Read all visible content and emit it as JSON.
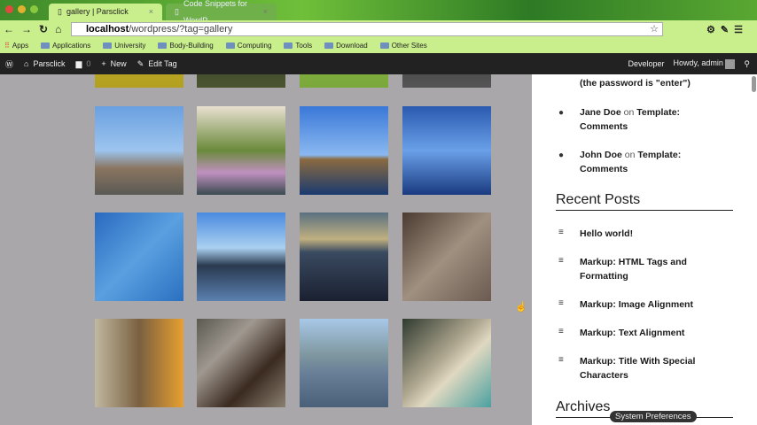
{
  "browser": {
    "tabs": [
      {
        "label": "gallery | Parsclick",
        "active": true
      },
      {
        "label": "Code Snippets for WordP",
        "active": false
      }
    ],
    "url_host": "localhost",
    "url_path": "/wordpress/?tag=gallery",
    "bookmarks": [
      "Apps",
      "Applications",
      "University",
      "Body-Building",
      "Computing",
      "Tools",
      "Download",
      "Other Sites"
    ]
  },
  "adminbar": {
    "site": "Parsclick",
    "comments": "0",
    "new": "New",
    "edit": "Edit Tag",
    "developer": "Developer",
    "howdy": "Howdy, admin"
  },
  "sidebar": {
    "comment_partial": "(the password is \"enter\")",
    "comments": [
      {
        "author": "Jane Doe",
        "on": "on",
        "post": "Template: Comments"
      },
      {
        "author": "John Doe",
        "on": "on",
        "post": "Template: Comments"
      }
    ],
    "recent_title": "Recent Posts",
    "recent": [
      "Hello world!",
      "Markup: HTML Tags and Formatting",
      "Markup: Image Alignment",
      "Markup: Text Alignment",
      "Markup: Title With Special Characters"
    ],
    "archives_title": "Archives"
  },
  "tooltip": "System Preferences",
  "gallery": [
    "linear-gradient(#c6b52a,#b4a020)",
    "linear-gradient(#2a3020,#4a5530)",
    "linear-gradient(#8fc04a,#7aa83a)",
    "linear-gradient(#2a2a30,#555)",
    "linear-gradient(#6aa0e0 0%,#9cc4ee 50%,#8a7560 70%,#5a5a55)",
    "linear-gradient(#e8e0d0,#6a8a3a 50%,#c090c0 75%,#3a4a50)",
    "linear-gradient(#3a78d8,#8ab8f0 55%,#8a6a40 60%,#1a3a70)",
    "linear-gradient(#2a5ab0,#6aa0e8 50%,#1a3a80)",
    "linear-gradient(135deg,#2a6ac0,#5aa0e0,#2a70c0)",
    "linear-gradient(#4a8ae0,#aad0f0 40%,#2a3a50 60%,#5a80b0)",
    "linear-gradient(#5a7080,#c0b080 30%,#3a4a60 45%,#1a2030)",
    "linear-gradient(135deg,#4a3a30,#a09080,#6a5a50)",
    "linear-gradient(90deg,#c0b8a0,#7a6040 50%,#e8a030)",
    "linear-gradient(135deg,#5a5a50,#a09890,#3a2a20,#8a8070)",
    "linear-gradient(#a8c8e8,#8098a0 40%,#6a8098 60%,#4a6078)",
    "linear-gradient(135deg,#303a30,#b0a890 45%,#e0d8c0 60%,#4aa0a0)"
  ]
}
